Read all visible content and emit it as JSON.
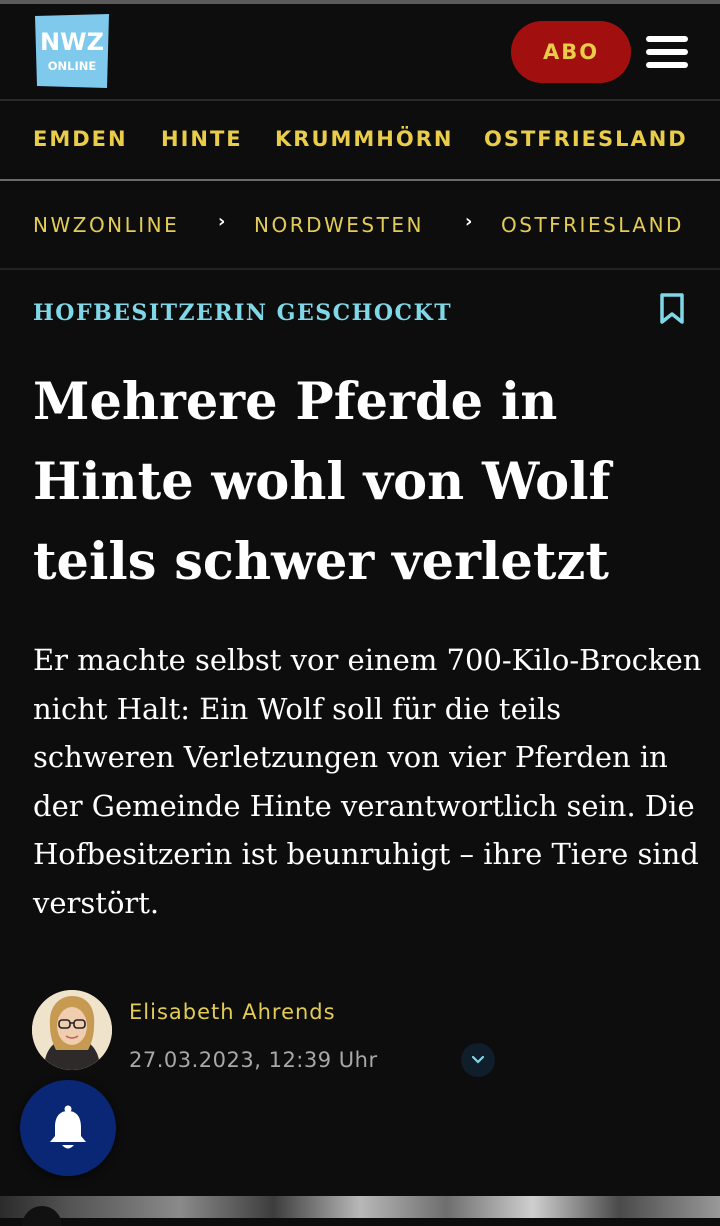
{
  "header": {
    "logo_line1": "NWZ",
    "logo_line2": "ONLINE",
    "abo_label": "ABO",
    "colors": {
      "abo_bg": "#a1100e",
      "accent_yellow": "#e8cc4a",
      "logo_blue": "#7ec9ec"
    }
  },
  "nav": {
    "items": [
      "EMDEN",
      "HINTE",
      "KRUMMHÖRN",
      "OSTFRIESLAND"
    ]
  },
  "breadcrumb": {
    "items": [
      "NWZONLINE",
      "NORDWESTEN",
      "OSTFRIESLAND"
    ],
    "separator": "›"
  },
  "article": {
    "kicker": "HOFBESITZERIN GESCHOCKT",
    "headline": "Mehrere Pferde in Hinte wohl von Wolf teils schwer verletzt",
    "teaser": "Er machte selbst vor einem 700-Kilo-Brocken nicht Halt: Ein Wolf soll für die teils schweren Verletzungen von vier Pferden in der Gemeinde Hinte verantwortlich sein. Die Hofbesitzerin ist beunruhigt – ihre Tiere sind verstört.",
    "author": "Elisabeth Ahrends",
    "date": "27.03.2023, 12:39 Uhr"
  },
  "icons": {
    "menu": "hamburger-menu-icon",
    "bookmark": "bookmark-icon",
    "expand": "chevron-down-icon",
    "notifications": "bell-icon"
  }
}
